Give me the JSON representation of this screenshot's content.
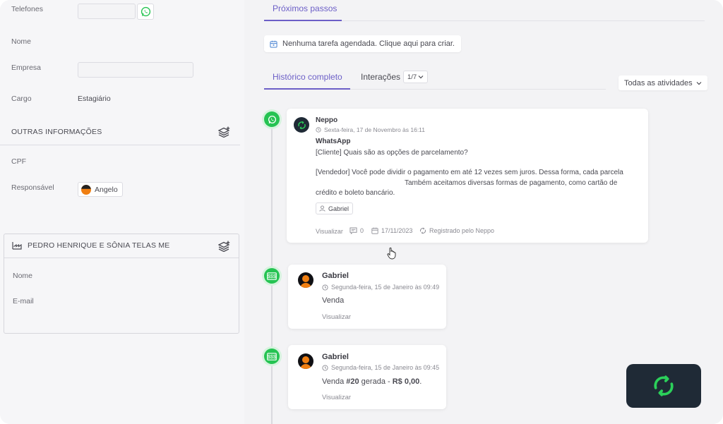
{
  "left": {
    "phones_label": "Telefones",
    "name_label": "Nome",
    "company_label": "Empresa",
    "role_label": "Cargo",
    "role_value": "Estagiário",
    "other_info_title": "OUTRAS INFORMAÇÕES",
    "cpf_label": "CPF",
    "responsible_label": "Responsável",
    "responsible_value": "Angelo",
    "company_card": {
      "title": "PEDRO HENRIQUE E SÔNIA TELAS ME",
      "name_label": "Nome",
      "email_label": "E-mail"
    }
  },
  "right": {
    "next_steps_tab": "Próximos passos",
    "no_task_text": "Nenhuma tarefa agendada. Clique aqui para criar.",
    "history_tab": "Histórico completo",
    "interactions_tab": "Interações",
    "interactions_count": "1/7",
    "filter_label": "Todas as atividades",
    "cards": [
      {
        "author": "Neppo",
        "time": "Sexta-feira, 17 de Novembro às 16:11",
        "channel": "WhatsApp",
        "line1": "[Cliente] Quais são as opções de parcelamento?",
        "line2": "[Vendedor] Você pode dividir o pagamento em até 12 vezes sem juros. Dessa forma, cada parcela",
        "line3": "Também aceitamos diversas formas de pagamento, como cartão de",
        "line4": "crédito e boleto bancário.",
        "tag": "Gabriel",
        "view_label": "Visualizar",
        "comments": "0",
        "date": "17/11/2023",
        "registered": "Registrado pelo Neppo"
      },
      {
        "author": "Gabriel",
        "time": "Segunda-feira, 15 de Janeiro às 09:49",
        "text": "Venda",
        "view_label": "Visualizar"
      },
      {
        "author": "Gabriel",
        "time": "Segunda-feira, 15 de Janeiro às 09:45",
        "text_prefix": "Venda ",
        "text_number": "#20",
        "text_mid": " gerada - ",
        "text_value": "R$ 0,00",
        "text_suffix": ".",
        "view_label": "Visualizar"
      }
    ]
  },
  "colors": {
    "accent": "#6c5fc7",
    "whatsapp_green": "#25c352",
    "neppo_dark": "#1f2a36",
    "neppo_green": "#2bd05a"
  }
}
